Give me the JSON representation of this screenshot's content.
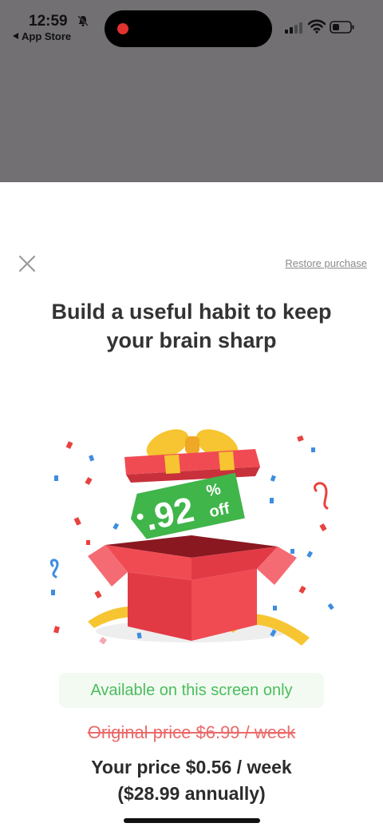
{
  "status_bar": {
    "time": "12:59",
    "back_label": "App Store",
    "icons": [
      "bell-slash-icon",
      "signal-icon",
      "wifi-icon",
      "battery-icon"
    ]
  },
  "sheet": {
    "restore_label": "Restore purchase",
    "headline_line1": "Build a useful habit to keep",
    "headline_line2": "your brain sharp",
    "discount_number": ".92",
    "discount_percent": "%",
    "discount_off": "off",
    "availability": "Available on this screen only",
    "original_price": "Original price $6.99 / week",
    "your_price_line1": "Your price $0.56 / week",
    "your_price_line2": "($28.99 annually)"
  },
  "colors": {
    "dim_overlay": "#727073",
    "accent_green": "#4bbd5c",
    "strike_red": "#ea6a6a",
    "gift_red": "#f04b53",
    "ribbon_yellow": "#f6c531"
  }
}
